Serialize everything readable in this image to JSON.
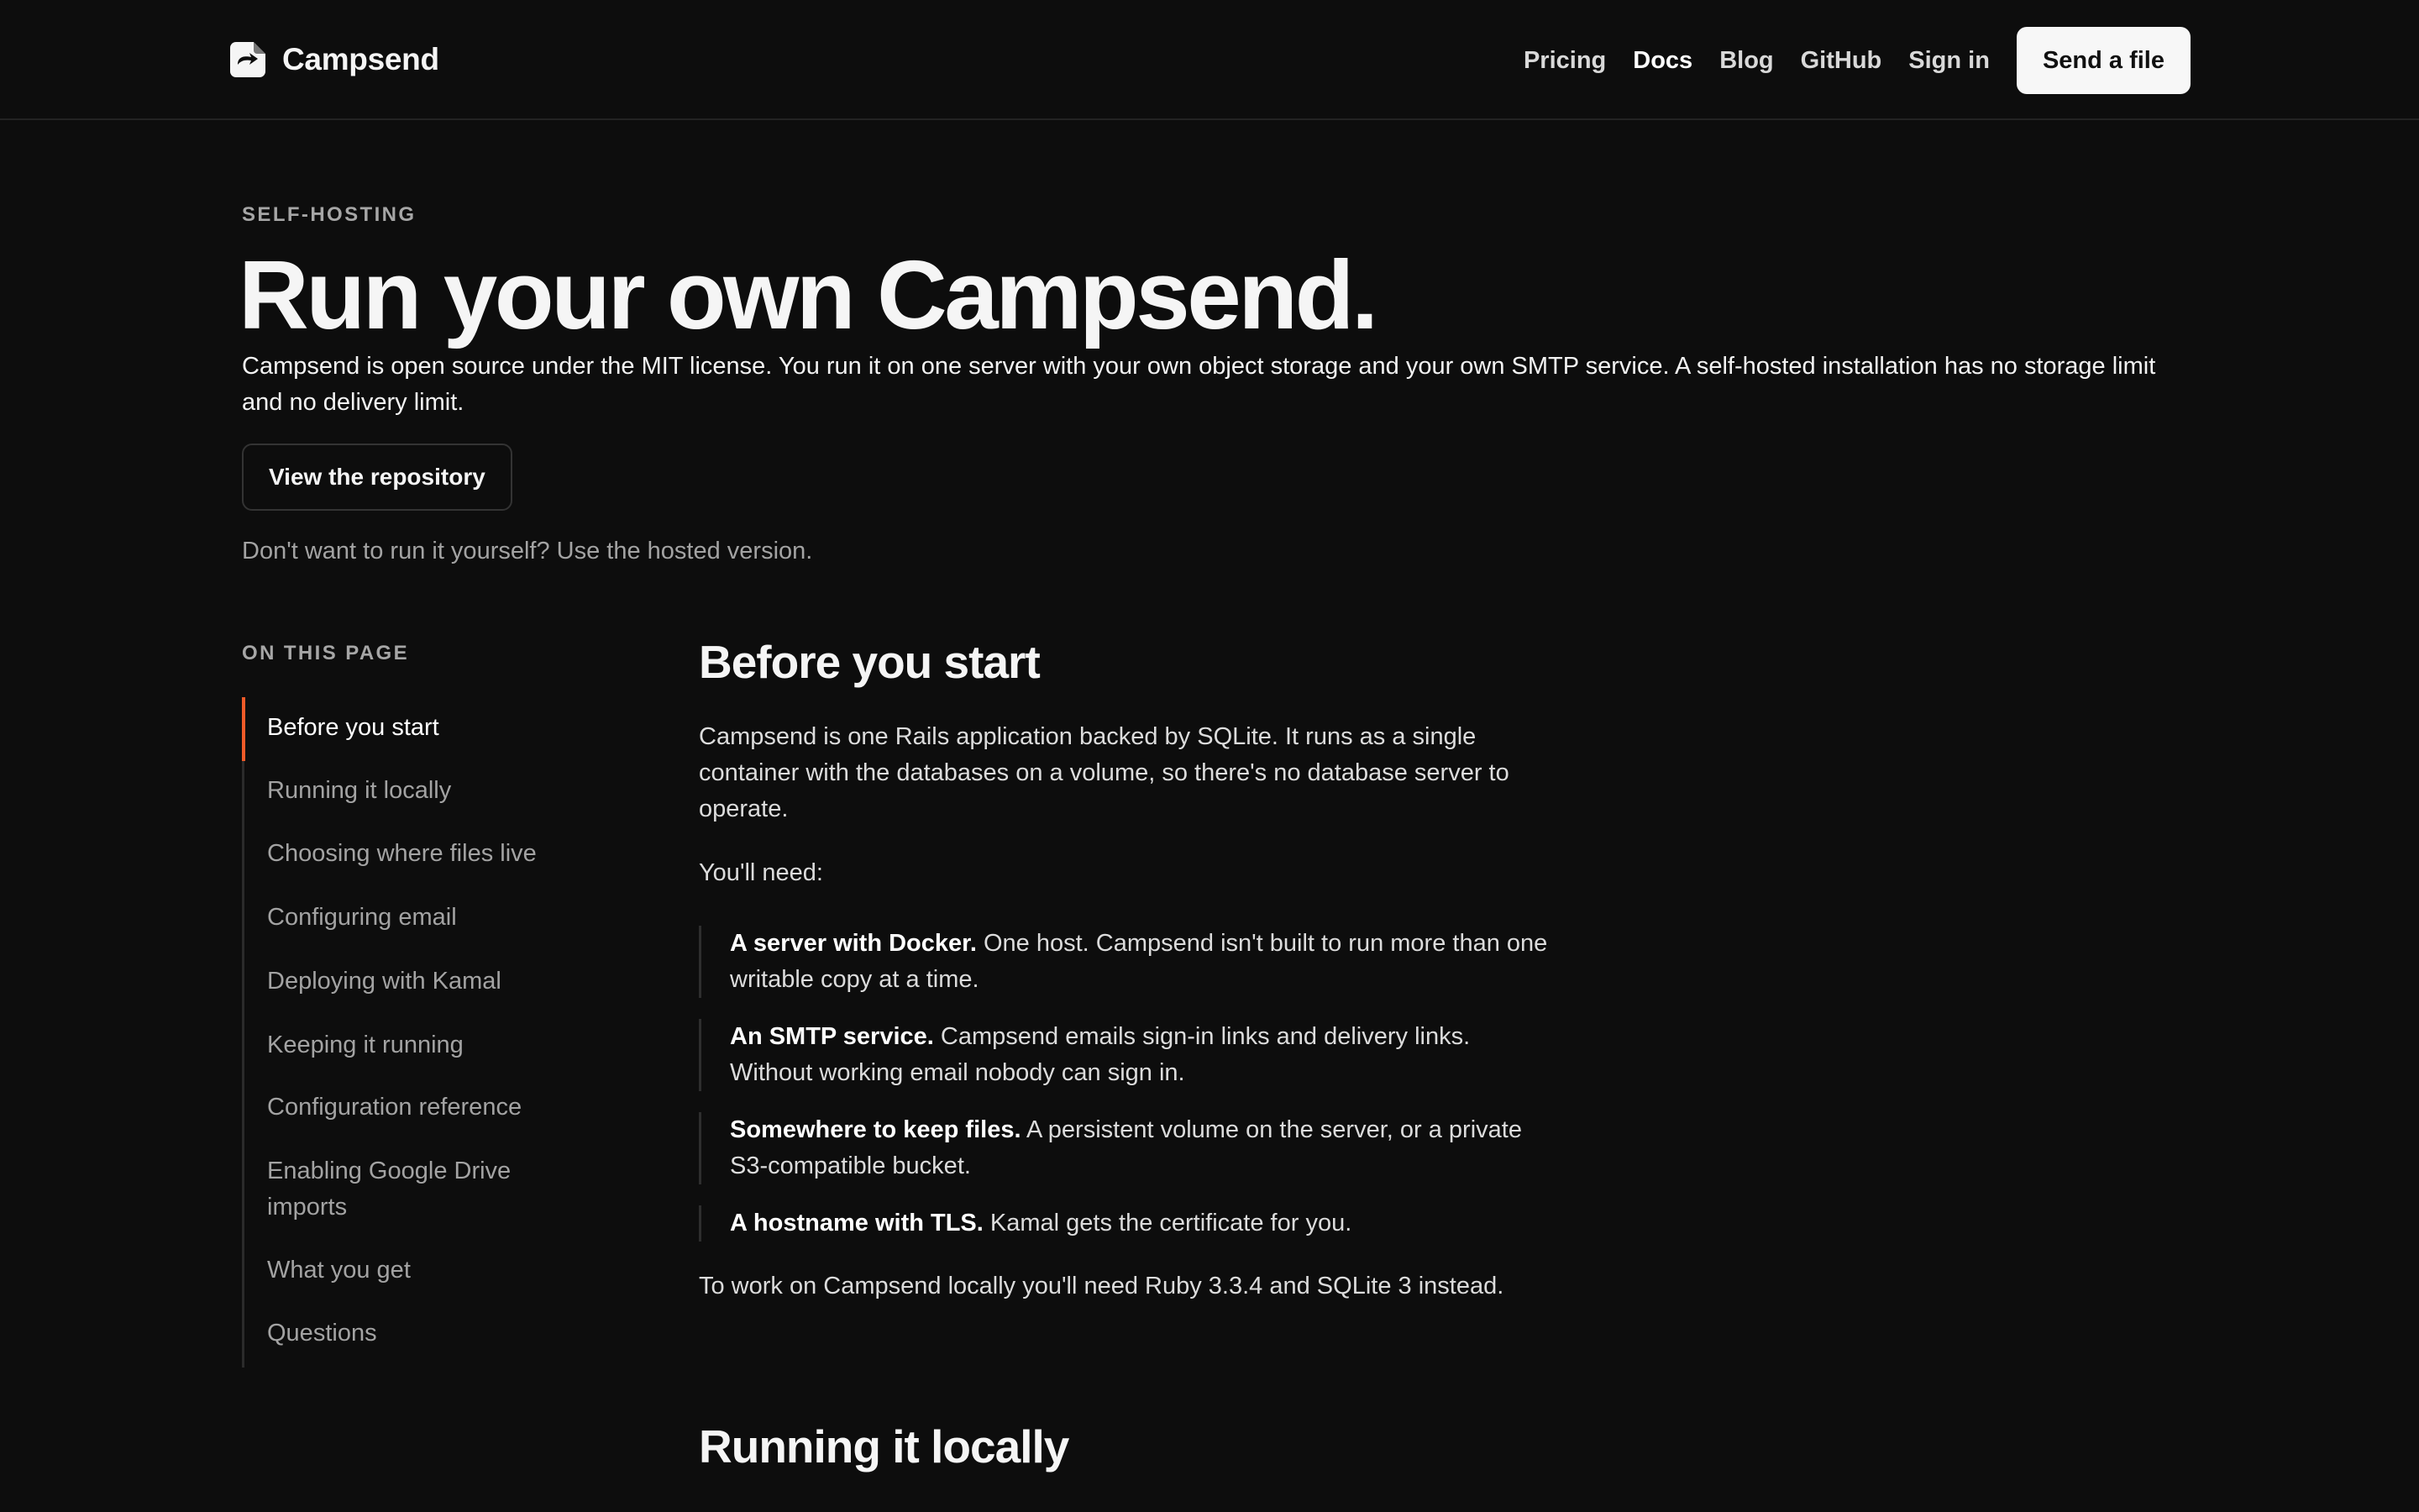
{
  "header": {
    "brand": "Campsend",
    "nav": [
      {
        "label": "Pricing",
        "active": false
      },
      {
        "label": "Docs",
        "active": true
      },
      {
        "label": "Blog",
        "active": false
      },
      {
        "label": "GitHub",
        "active": false
      },
      {
        "label": "Sign in",
        "active": false
      }
    ],
    "cta_label": "Send a file"
  },
  "hero": {
    "eyebrow": "SELF-HOSTING",
    "title": "Run your own Campsend.",
    "lead": "Campsend is open source under the MIT license. You run it on one server with your own object storage and your own SMTP service. A self-hosted installation has no storage limit and no delivery limit.",
    "repo_button": "View the repository",
    "hosted_note": "Don't want to run it yourself? Use the hosted version."
  },
  "toc": {
    "heading": "ON THIS PAGE",
    "active_index": 0,
    "items": [
      "Before you start",
      "Running it locally",
      "Choosing where files live",
      "Configuring email",
      "Deploying with Kamal",
      "Keeping it running",
      "Configuration reference",
      "Enabling Google Drive imports",
      "What you get",
      "Questions"
    ]
  },
  "content": {
    "before": {
      "title": "Before you start",
      "intro": "Campsend is one Rails application backed by SQLite. It runs as a single container with the databases on a volume, so there's no database server to operate.",
      "need": "You'll need:",
      "requirements": [
        {
          "term": "A server with Docker.",
          "desc": "One host. Campsend isn't built to run more than one writable copy at a time."
        },
        {
          "term": "An SMTP service.",
          "desc": "Campsend emails sign-in links and delivery links. Without working email nobody can sign in."
        },
        {
          "term": "Somewhere to keep files.",
          "desc": "A persistent volume on the server, or a private S3-compatible bucket."
        },
        {
          "term": "A hostname with TLS.",
          "desc": "Kamal gets the certificate for you."
        }
      ],
      "local_note": "To work on Campsend locally you'll need Ruby 3.3.4 and SQLite 3 instead."
    },
    "running": {
      "title": "Running it locally"
    }
  },
  "colors": {
    "background": "#0d0d0d",
    "accent": "#f05a28",
    "muted_text": "#a3a3a3"
  },
  "icons": {
    "brand_logo": "campsend-logo-icon"
  }
}
